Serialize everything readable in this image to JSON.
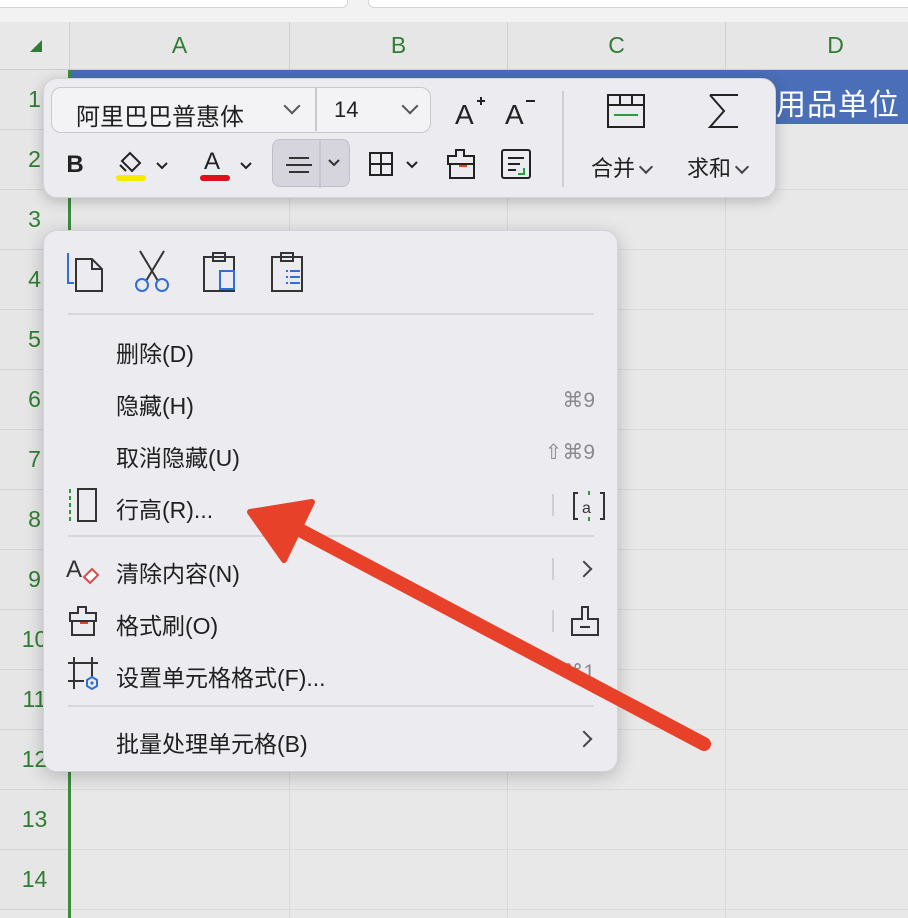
{
  "sheet": {
    "columns": [
      "A",
      "B",
      "C",
      "D"
    ],
    "rows": [
      "1",
      "2",
      "3",
      "4",
      "5",
      "6",
      "7",
      "8",
      "9",
      "10",
      "11",
      "12",
      "13",
      "14"
    ],
    "title_cell_text": "用品单位"
  },
  "toolbar": {
    "font_name": "阿里巴巴普惠体",
    "font_size": "14",
    "merge_label": "合并",
    "sum_label": "求和",
    "highlight_color": "#f5ea00",
    "font_color": "#e0101a"
  },
  "menu": {
    "items": [
      {
        "label": "删除(D)",
        "shortcut": ""
      },
      {
        "label": "隐藏(H)",
        "shortcut": "⌘9"
      },
      {
        "label": "取消隐藏(U)",
        "shortcut": "⇧⌘9"
      },
      {
        "label": "行高(R)...",
        "shortcut": ""
      },
      {
        "label": "清除内容(N)",
        "shortcut": ""
      },
      {
        "label": "格式刷(O)",
        "shortcut": ""
      },
      {
        "label": "设置单元格格式(F)...",
        "shortcut": "⌘1"
      },
      {
        "label": "批量处理单元格(B)",
        "shortcut": ""
      }
    ]
  },
  "annotation": {
    "arrow_color": "#e8412a"
  }
}
